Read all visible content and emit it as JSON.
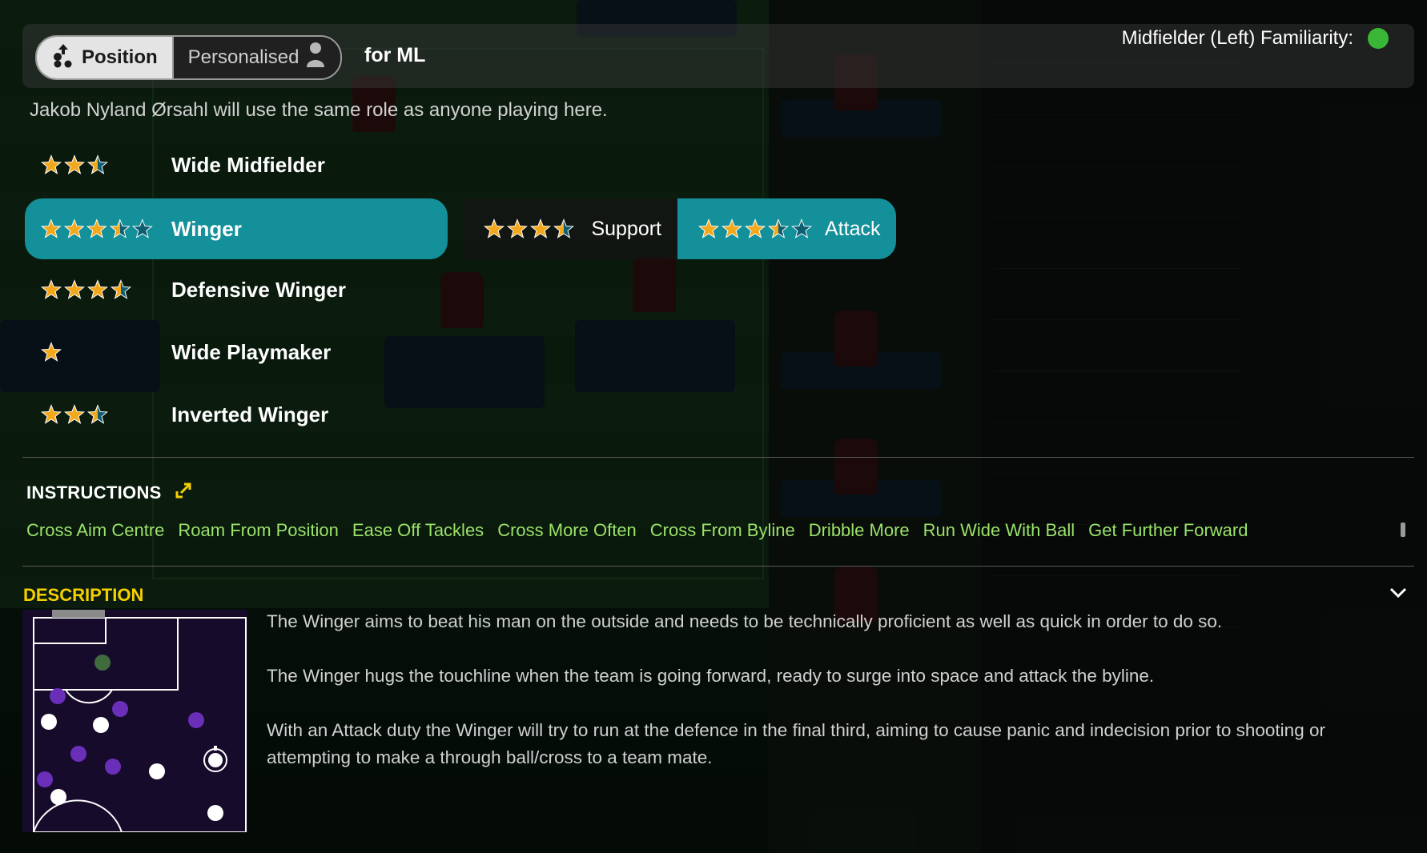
{
  "header": {
    "tab_position": "Position",
    "tab_personalised": "Personalised",
    "for_label": "for ML",
    "familiarity_label": "Midfielder (Left) Familiarity:",
    "familiarity_color": "#39b636"
  },
  "same_role_text": "Jakob Nyland Ørsahl will use the same role as anyone playing here.",
  "roles": [
    {
      "name": "Wide Midfielder",
      "stars": 2.5,
      "selected": false
    },
    {
      "name": "Winger",
      "stars": 3.5,
      "selected": true
    },
    {
      "name": "Defensive Winger",
      "stars": 3.5,
      "selected": false
    },
    {
      "name": "Wide Playmaker",
      "stars": 1,
      "selected": false
    },
    {
      "name": "Inverted Winger",
      "stars": 2.5,
      "selected": false
    }
  ],
  "duties": [
    {
      "label": "Support",
      "stars": 3.5,
      "selected": false
    },
    {
      "label": "Attack",
      "stars": 3.5,
      "selected": true
    }
  ],
  "instructions": {
    "heading": "INSTRUCTIONS",
    "items": [
      "Cross Aim Centre",
      "Roam From Position",
      "Ease Off Tackles",
      "Cross More Often",
      "Cross From Byline",
      "Dribble More",
      "Run Wide With Ball",
      "Get Further Forward"
    ],
    "color": "#9be36a"
  },
  "description": {
    "heading": "DESCRIPTION",
    "heading_color": "#f5d000",
    "paragraphs": [
      "The Winger aims to beat his man on the outside and needs to be technically proficient as well as quick in order to do so.",
      "The Winger hugs the touchline when the team is going forward, ready to surge into space and attack the byline.",
      "With an Attack duty the Winger will try to run at the defence in the final third, aiming to cause panic and indecision prior to shooting or attempting to make a through ball/cross to a team mate."
    ]
  },
  "colors": {
    "accent_teal": "#139099",
    "star_gold": "#f3a81c",
    "star_empty": "#0e5e72"
  },
  "icons": {
    "position_tab": "formation-icon",
    "personalised_tab": "person-icon",
    "instructions": "expand-icon",
    "description": "chevron-down-icon"
  }
}
